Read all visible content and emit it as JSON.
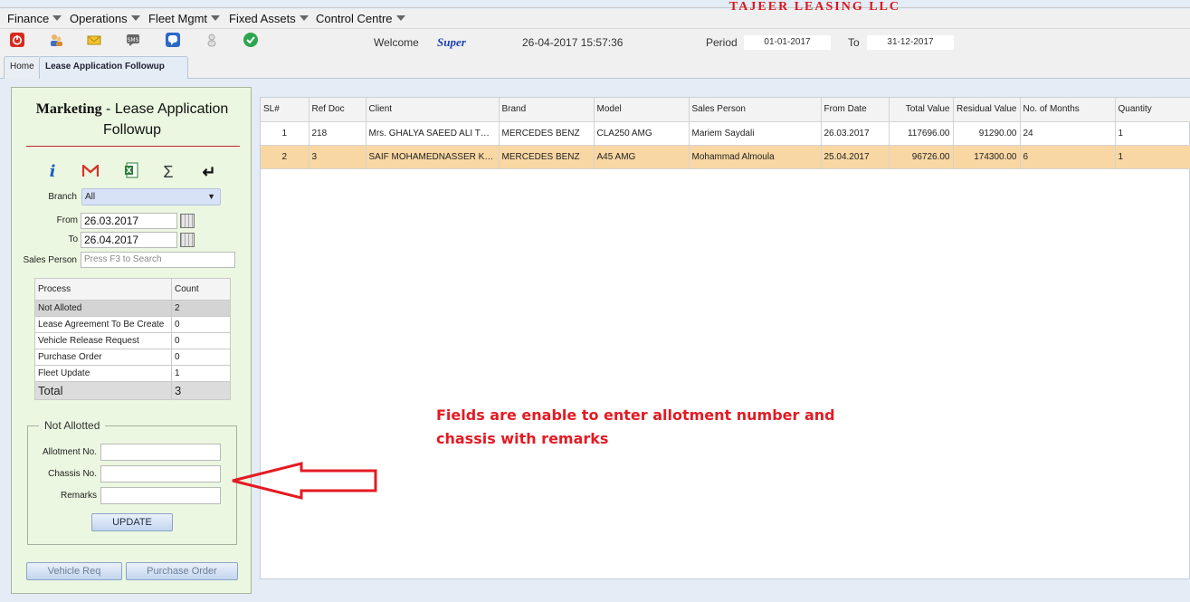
{
  "menubar": {
    "items": [
      {
        "label": "Finance"
      },
      {
        "label": "Operations"
      },
      {
        "label": "Fleet Mgmt"
      },
      {
        "label": "Fixed Assets"
      },
      {
        "label": "Control Centre"
      }
    ],
    "company": "TAJEER LEASING LLC"
  },
  "toolbar": {
    "icons": [
      "power-icon",
      "users-icon",
      "mail-icon",
      "sms-icon",
      "chat-icon",
      "user-icon",
      "check-icon"
    ],
    "welcome_label": "Welcome",
    "user_name": "Super",
    "datetime": "26-04-2017 15:57:36",
    "period_label": "Period",
    "period_from": "01-01-2017",
    "to_label": "To",
    "period_to": "31-12-2017"
  },
  "tabs": [
    {
      "label": "Home"
    },
    {
      "label": "Lease Application Followup"
    }
  ],
  "left_panel": {
    "title_bold": "Marketing",
    "title_rest": " - Lease Application Followup",
    "icons": [
      "info-icon",
      "gmail-icon",
      "excel-icon",
      "sigma-icon",
      "return-icon"
    ],
    "branch_label": "Branch",
    "branch_value": "All",
    "from_label": "From",
    "from_value": "26.03.2017",
    "to_label": "To",
    "to_value": "26.04.2017",
    "sales_person_label": "Sales Person",
    "sales_person_placeholder": "Press F3 to Search",
    "process_table": {
      "headers": [
        "Process",
        "Count"
      ],
      "rows": [
        {
          "process": "Not Alloted",
          "count": "2"
        },
        {
          "process": "Lease Agreement To Be Create",
          "count": "0"
        },
        {
          "process": "Vehicle Release Request",
          "count": "0"
        },
        {
          "process": "Purchase Order",
          "count": "0"
        },
        {
          "process": "Fleet Update",
          "count": "1"
        }
      ],
      "total_label": "Total",
      "total_count": "3"
    },
    "not_allotted": {
      "legend": "Not Allotted",
      "allotment_label": "Allotment No.",
      "chassis_label": "Chassis No.",
      "remarks_label": "Remarks",
      "update_label": "UPDATE"
    },
    "vehicle_req_label": "Vehicle Req",
    "purchase_order_label": "Purchase Order"
  },
  "grid": {
    "headers": [
      "SL#",
      "Ref Doc",
      "Client",
      "Brand",
      "Model",
      "Sales Person",
      "From Date",
      "Total Value",
      "Residual Value",
      "No. of Months",
      "Quantity"
    ],
    "rows": [
      {
        "sl": "1",
        "ref": "218",
        "client": "Mrs. GHALYA SAEED ALI THU...",
        "brand": "MERCEDES BENZ",
        "model": "CLA250 AMG",
        "sales": "Mariem Saydali",
        "from": "26.03.2017",
        "total": "117696.00",
        "residual": "91290.00",
        "months": "24",
        "qty": "1"
      },
      {
        "sl": "2",
        "ref": "3",
        "client": "SAIF MOHAMEDNASSER KHA...",
        "brand": "MERCEDES BENZ",
        "model": "A45 AMG",
        "sales": "Mohammad Almoula",
        "from": "25.04.2017",
        "total": "96726.00",
        "residual": "174300.00",
        "months": "6",
        "qty": "1"
      }
    ]
  },
  "annotation": {
    "line1": "Fields are enable to enter allotment number and",
    "line2": "chassis with remarks"
  }
}
